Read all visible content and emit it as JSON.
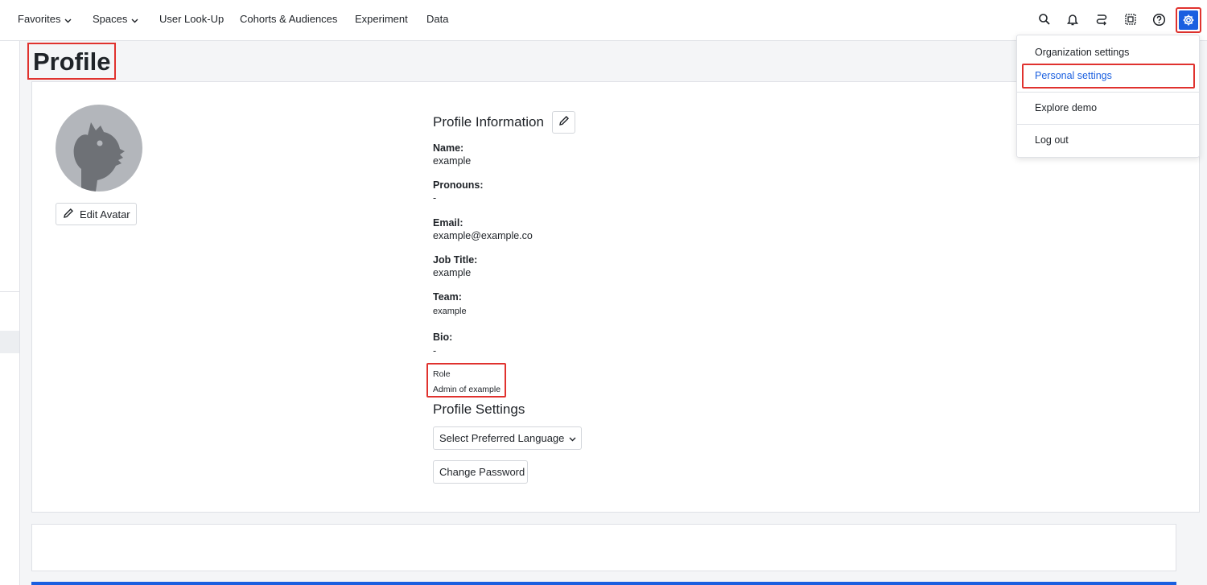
{
  "nav": {
    "items": [
      {
        "label": "Favorites",
        "has_dropdown": true
      },
      {
        "label": "Spaces",
        "has_dropdown": true
      },
      {
        "label": "User Look-Up",
        "has_dropdown": false
      },
      {
        "label": "Cohorts & Audiences",
        "has_dropdown": false
      },
      {
        "label": "Experiment",
        "has_dropdown": false
      },
      {
        "label": "Data",
        "has_dropdown": false
      }
    ],
    "icons": [
      "search-icon",
      "bell-icon",
      "route-icon",
      "grid-icon",
      "help-icon",
      "gear-icon"
    ]
  },
  "page": {
    "title": "Profile"
  },
  "profile": {
    "edit_avatar_label": "Edit Avatar",
    "info_title": "Profile Information",
    "fields": {
      "name": {
        "label": "Name:",
        "value": "example"
      },
      "pronouns": {
        "label": "Pronouns:",
        "value": "-"
      },
      "email": {
        "label": "Email:",
        "value": "example@example.co"
      },
      "job_title": {
        "label": "Job Title:",
        "value": "example"
      },
      "team": {
        "label": "Team:",
        "value": "example"
      },
      "bio": {
        "label": "Bio:",
        "value": "-"
      }
    },
    "role": {
      "label": "Role",
      "value": "Admin of example"
    },
    "settings_title": "Profile Settings",
    "language_select_label": "Select Preferred Language",
    "change_password_label": "Change Password"
  },
  "settings_menu": {
    "items": [
      {
        "label": "Organization settings"
      },
      {
        "label": "Personal settings"
      },
      {
        "label": "Explore demo"
      },
      {
        "label": "Log out"
      }
    ]
  },
  "colors": {
    "accent": "#1a5fe0",
    "highlight_box": "#e0322e"
  }
}
